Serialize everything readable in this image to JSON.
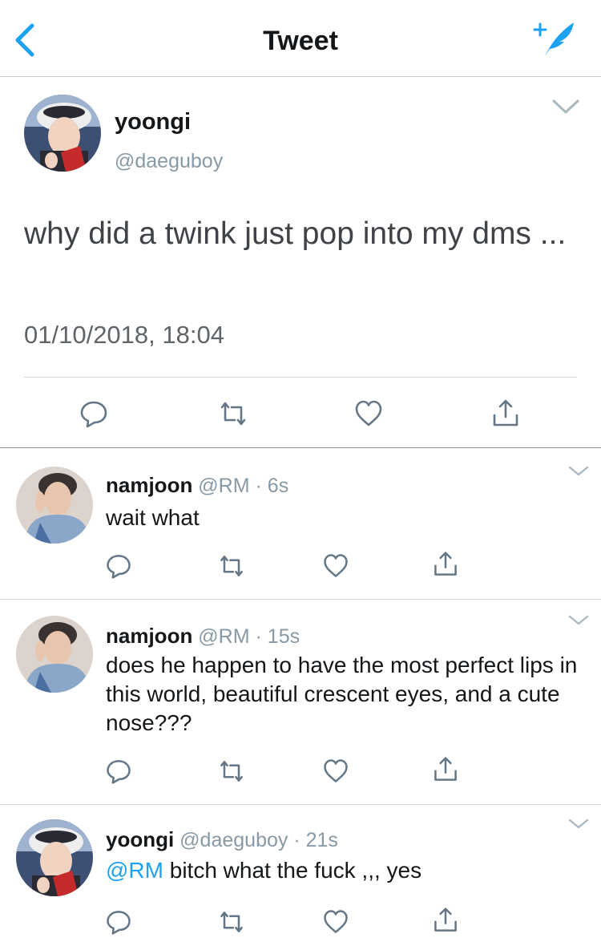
{
  "nav": {
    "title": "Tweet",
    "back_icon": "chevron-left-icon",
    "compose_icon": "compose-tweet-icon"
  },
  "tweet": {
    "name": "yoongi",
    "handle": "@daeguboy",
    "text": "why did a twink just pop into my dms ...",
    "date": "01/10/2018, 18:04"
  },
  "replies": [
    {
      "name": "namjoon",
      "handle": "@RM",
      "time": "6s",
      "mention": "",
      "text": "wait what"
    },
    {
      "name": "namjoon",
      "handle": "@RM",
      "time": "15s",
      "mention": "",
      "text": "does he happen to have the most perfect lips in this world, beautiful crescent eyes, and a cute nose???"
    },
    {
      "name": "yoongi",
      "handle": "@daeguboy",
      "time": "21s",
      "mention": "@RM",
      "text": "bitch what the fuck ,,, yes"
    }
  ],
  "colors": {
    "accent": "#1da1f2",
    "icon": "#657786",
    "muted": "#8899a6"
  }
}
